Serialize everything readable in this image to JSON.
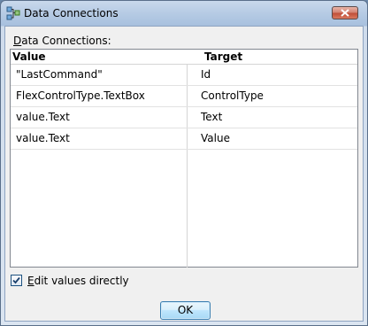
{
  "window": {
    "title": "Data Connections",
    "icon": "data-connections-icon",
    "close_icon": "close-icon"
  },
  "section_label": {
    "accel": "D",
    "rest": "ata Connections:"
  },
  "grid": {
    "columns": {
      "value": "Value",
      "target": "Target"
    },
    "rows": [
      {
        "value": "\"LastCommand\"",
        "target": "Id"
      },
      {
        "value": "FlexControlType.TextBox",
        "target": "ControlType"
      },
      {
        "value": "value.Text",
        "target": "Text"
      },
      {
        "value": "value.Text",
        "target": "Value"
      }
    ]
  },
  "edit_directly": {
    "checked": true,
    "accel": "E",
    "rest": "dit values directly"
  },
  "ok_button": {
    "label": "OK"
  },
  "colors": {
    "close_red": "#c0503a",
    "ok_border": "#3c7fb1"
  }
}
